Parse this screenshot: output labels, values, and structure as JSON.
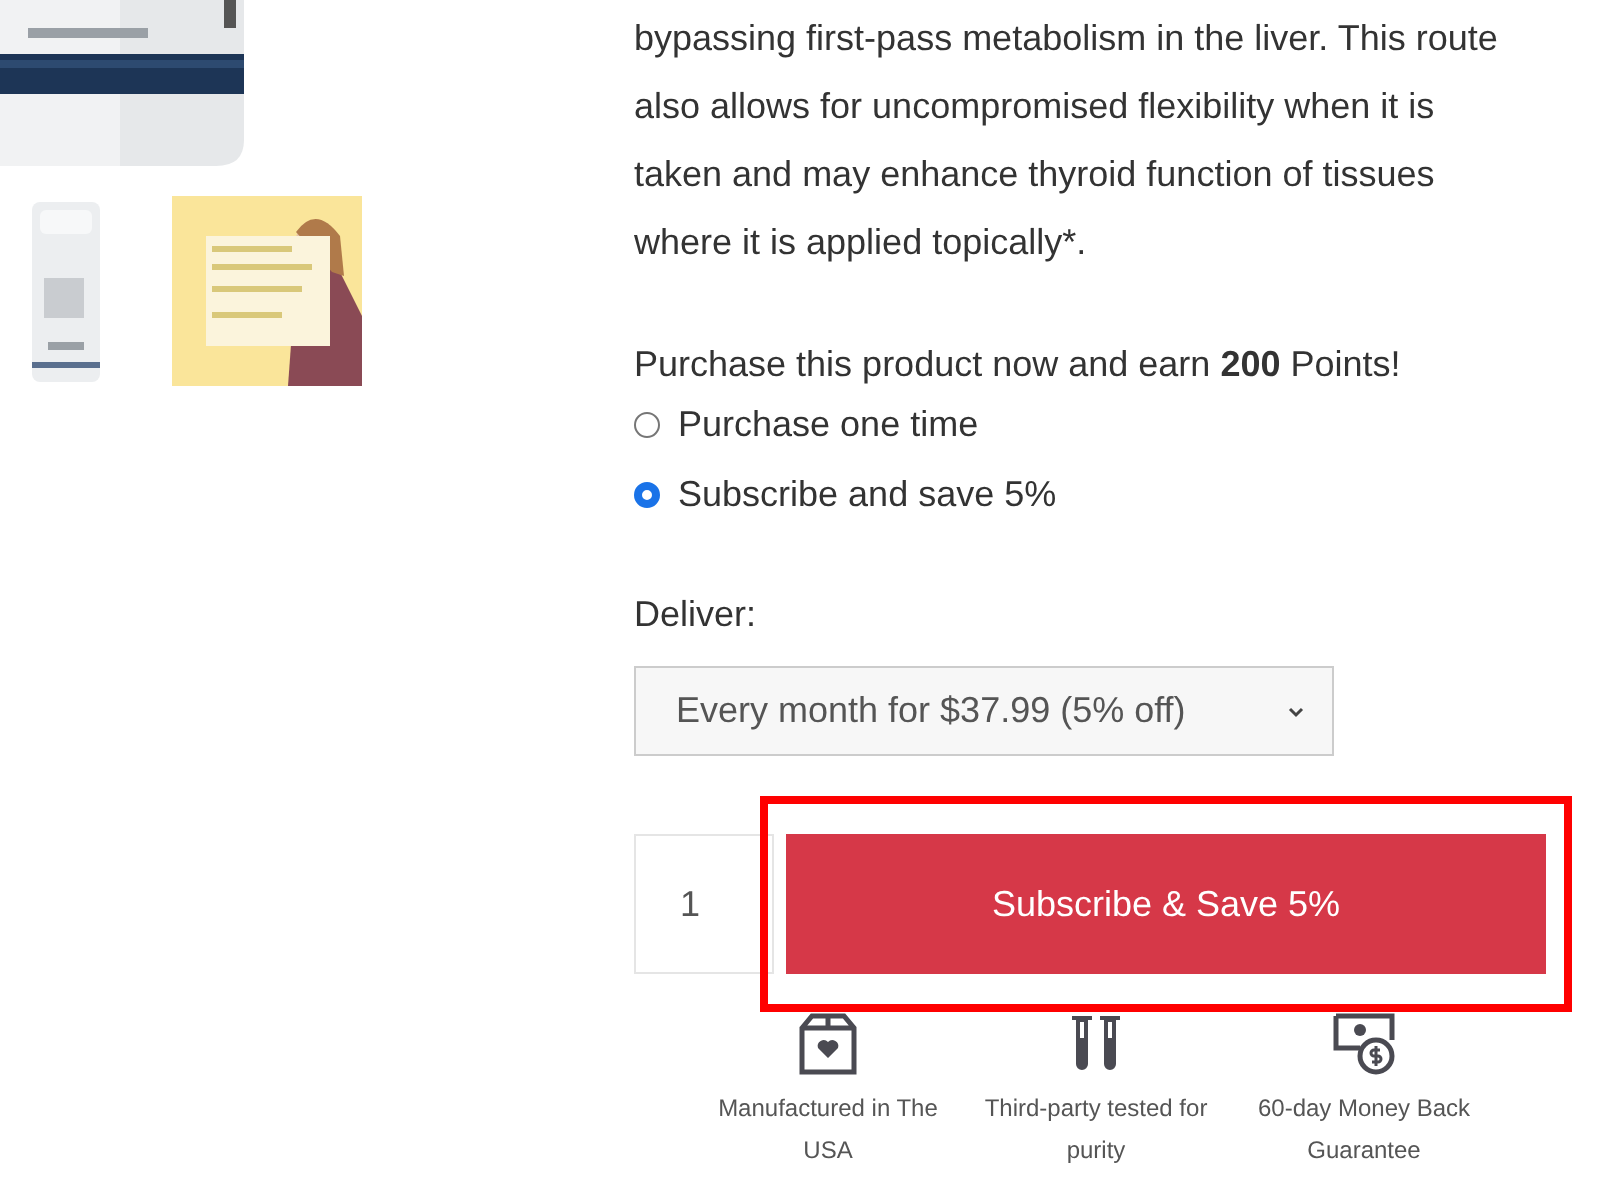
{
  "description": "bypassing first-pass metabolism in the liver. This route also allows for uncompromised flexibility when it is taken and may enhance thyroid function of tissues where it is applied topically*.",
  "points_note": "Purchase this product now and earn **200** Points!",
  "purchase_options": [
    {
      "label": "Purchase one time",
      "selected": false
    },
    {
      "label": "Subscribe and save 5%",
      "selected": true
    }
  ],
  "deliver": {
    "label": "Deliver:",
    "value": "Every month for $37.99 (5% off)"
  },
  "quantity": "1",
  "add_button": {
    "label": "Subscribe & Save 5%",
    "highlighted": true
  },
  "features": [
    {
      "kind": "box",
      "label": "Manufactured in The USA"
    },
    {
      "kind": "tubes",
      "label": "Third-party tested for purity"
    },
    {
      "kind": "money",
      "label": "60-day Money Back Guarantee"
    }
  ]
}
